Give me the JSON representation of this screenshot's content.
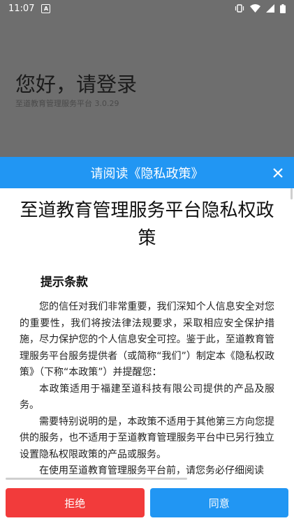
{
  "status_bar": {
    "time": "11:07",
    "badge": "A",
    "icons": [
      "vibrate-icon",
      "wifi-icon",
      "signal-icon",
      "battery-icon"
    ]
  },
  "login": {
    "title": "您好，请登录",
    "subtitle": "至道教育管理服务平台 3.0.29"
  },
  "dialog": {
    "header_title": "请阅读《隐私政策》",
    "doc_title": "至道教育管理服务平台隐私权政策",
    "section_title": "提示条款",
    "paragraphs": [
      "您的信任对我们非常重要，我们深知个人信息安全对您的重要性，我们将按法律法规要求，采取相应安全保护措施，尽力保护您的个人信息安全可控。鉴于此，至道教育管理服务平台服务提供者（或简称“我们”）制定本《隐私权政策》（下称“本政策”）并提醒您：",
      "本政策适用于福建至道科技有限公司提供的产品及服务。",
      "需要特别说明的是，本政策不适用于其他第三方向您提供的服务，也不适用于至道教育管理服务平台中已另行独立设置隐私权限政策的产品或服务。",
      "在使用至道教育管理服务平台前，请您务必仔细阅读"
    ],
    "reject_label": "拒绝",
    "agree_label": "同意"
  },
  "colors": {
    "accent": "#2196f3",
    "reject": "#f23b3b",
    "overlay": "#6e6e6e"
  }
}
